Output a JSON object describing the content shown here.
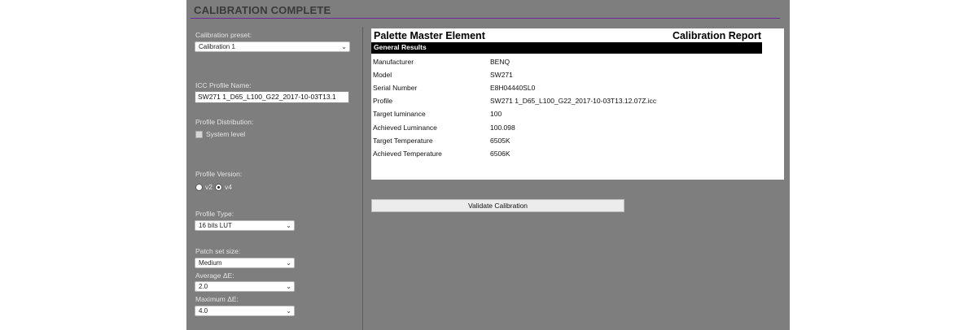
{
  "header": {
    "title": "CALIBRATION COMPLETE"
  },
  "left": {
    "preset": {
      "label": "Calibration preset:",
      "value": "Calibration 1"
    },
    "icc": {
      "label": "ICC Profile Name:",
      "value": "SW271 1_D65_L100_G22_2017-10-03T13.1"
    },
    "distribution": {
      "label": "Profile Distribution:",
      "option_label": "System level",
      "checked": false
    },
    "version": {
      "label": "Profile Version:",
      "options": [
        "v2",
        "v4"
      ],
      "selected": "v4"
    },
    "type": {
      "label": "Profile Type:",
      "value": "16 bits LUT"
    },
    "patch": {
      "label": "Patch set size:",
      "value": "Medium"
    },
    "avg": {
      "label": "Average ΔE:",
      "value": "2.0"
    },
    "max": {
      "label": "Maximum ΔE:",
      "value": "4.0"
    }
  },
  "report": {
    "app_name": "Palette Master Element",
    "title": "Calibration Report",
    "section": "General Results",
    "rows": [
      {
        "label": "Manufacturer",
        "value": "BENQ"
      },
      {
        "label": "Model",
        "value": "SW271"
      },
      {
        "label": "Serial Number",
        "value": "E8H04440SL0"
      },
      {
        "label": "Profile",
        "value": "SW271 1_D65_L100_G22_2017-10-03T13.12.07Z.icc"
      },
      {
        "label": "Target luminance",
        "value": "100"
      },
      {
        "label": "Achieved Luminance",
        "value": "100.098"
      },
      {
        "label": "Target Temperature",
        "value": "6505K"
      },
      {
        "label": "Achieved Temperature",
        "value": "6506K"
      }
    ]
  },
  "validate_button": {
    "label": "Validate Calibration"
  },
  "colors": {
    "panel_bg": "#7e7e7e",
    "accent_rule": "#6b2a9a"
  }
}
